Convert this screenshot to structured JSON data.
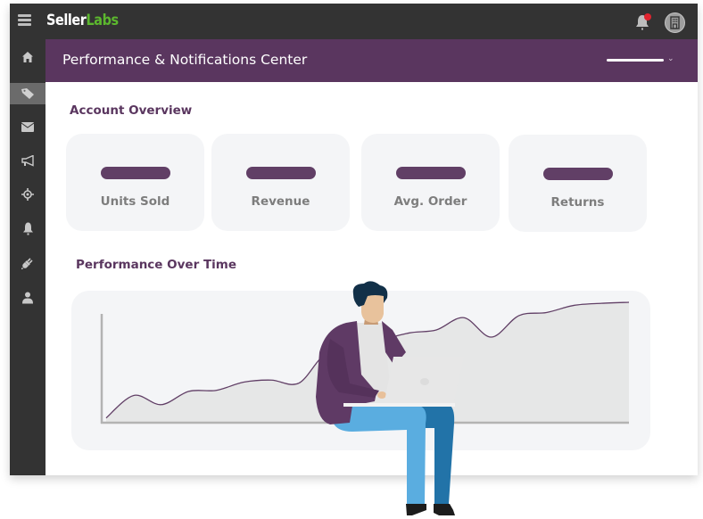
{
  "topbar": {
    "menu_icon": "hamburger-icon",
    "logo_part1": "Seller",
    "logo_part2": "Labs",
    "notifications_icon": "bell-icon",
    "notification_dot_color": "#e0242f",
    "account_icon": "building-icon"
  },
  "sidebar": {
    "items": [
      {
        "icon": "home-icon",
        "active": false
      },
      {
        "icon": "tag-icon",
        "active": true
      },
      {
        "icon": "envelope-icon",
        "active": false
      },
      {
        "icon": "megaphone-icon",
        "active": false
      },
      {
        "icon": "crosshair-icon",
        "active": false
      },
      {
        "icon": "bell-icon",
        "active": false
      },
      {
        "icon": "plug-icon",
        "active": false
      },
      {
        "icon": "user-icon",
        "active": false
      }
    ]
  },
  "header": {
    "title": "Performance & Notifications Center",
    "dropdown_icon": "chevron-down-icon"
  },
  "account_overview": {
    "title": "Account Overview",
    "cards": [
      {
        "label": "Units Sold"
      },
      {
        "label": "Revenue"
      },
      {
        "label": "Avg. Order"
      },
      {
        "label": "Returns"
      }
    ]
  },
  "performance": {
    "title": "Performance Over Time"
  },
  "colors": {
    "brand_purple": "#5a365f",
    "pill_purple": "#613f66",
    "logo_green": "#5cb82e",
    "dark_bar": "#333333"
  },
  "chart_data": {
    "type": "area",
    "title": "Performance Over Time",
    "xlabel": "",
    "ylabel": "",
    "grid": false,
    "legend": "none",
    "x": [
      0,
      1,
      2,
      3,
      4,
      5,
      6,
      7,
      8,
      9,
      10,
      11,
      12,
      13,
      14,
      15,
      16,
      17,
      18,
      19
    ],
    "values": [
      2,
      24,
      15,
      28,
      29,
      37,
      39,
      36,
      64,
      53,
      76,
      85,
      88,
      100,
      81,
      102,
      105,
      112,
      114,
      115
    ],
    "ylim": [
      0,
      130
    ]
  }
}
